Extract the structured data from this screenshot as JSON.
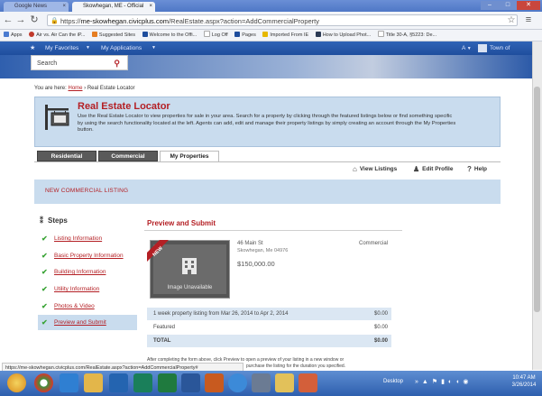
{
  "browser": {
    "tabs": [
      {
        "label": "Google News",
        "active": false
      },
      {
        "label": "Skowhegan, ME - Official",
        "active": true
      }
    ],
    "url_prefix": "https://",
    "url_host": "me-skowhegan.civicplus.com",
    "url_path": "/RealEstate.aspx?action=AddCommercialProperty",
    "bookmarks": [
      {
        "label": "Apps",
        "color": "#4a7bd0"
      },
      {
        "label": "Air vs. Air Can the iP...",
        "color": "#c0392b"
      },
      {
        "label": "Suggested Sites",
        "color": "#e67e22"
      },
      {
        "label": "Welcome to the Offi...",
        "color": "#1f4e9d"
      },
      {
        "label": "Log Off",
        "color": "#cccccc"
      },
      {
        "label": "Pages",
        "color": "#1f4e9d"
      },
      {
        "label": "Imported From IE",
        "color": "#e6b800"
      },
      {
        "label": "How to Upload Phot...",
        "color": "#2b3a55"
      },
      {
        "label": "Title 30-A, §5223: De...",
        "color": "#cccccc"
      }
    ],
    "status_url": "https://me-skowhegan.civicplus.com/RealEstate.aspx?action=AddCommercialProperty#"
  },
  "site": {
    "nav": {
      "favorites": "My Favorites",
      "applications": "My Applications",
      "town": "Town of"
    },
    "search_placeholder": "Search",
    "breadcrumb": {
      "prefix": "You are here:",
      "home": "Home",
      "current": "Real Estate Locator"
    },
    "title": "Real Estate Locator",
    "description": "Use the Real Estate Locator to view properties for sale in your area. Search for a property by clicking through the featured listings below or find something specific by using the search functionality located at the left. Agents can add, edit and manage their property listings by simply creating an account through the My Properties button.",
    "tabs": [
      {
        "label": "Residential",
        "active": false
      },
      {
        "label": "Commercial",
        "active": false
      },
      {
        "label": "My Properties",
        "active": true
      }
    ],
    "toolbar": {
      "view_listings": "View Listings",
      "edit_profile": "Edit Profile",
      "help": "Help"
    },
    "new_listing_label": "NEW COMMERCIAL LISTING"
  },
  "steps": {
    "title": "Steps",
    "items": [
      {
        "label": "Listing Information",
        "done": true,
        "active": false
      },
      {
        "label": "Basic Property Information",
        "done": true,
        "active": false
      },
      {
        "label": "Building Information",
        "done": true,
        "active": false
      },
      {
        "label": "Utility Information",
        "done": true,
        "active": false
      },
      {
        "label": "Photos & Video",
        "done": true,
        "active": false
      },
      {
        "label": "Preview and Submit",
        "done": true,
        "active": true
      }
    ]
  },
  "preview": {
    "title": "Preview and Submit",
    "ribbon": "NEW",
    "image_label": "Image Unavailable",
    "address": "46 Main St",
    "city": "Skowhegan, Me 04976",
    "price": "$150,000.00",
    "type": "Commercial",
    "fees": [
      {
        "label": "1 week property listing from Mar 26, 2014 to Apr 2, 2014",
        "amount": "$0.00",
        "style": "blue"
      },
      {
        "label": "Featured",
        "amount": "$0.00",
        "style": "plain"
      },
      {
        "label": "TOTAL",
        "amount": "$0.00",
        "style": "total"
      }
    ],
    "note_line1": "After completing the form above, click Preview to open a preview of your listing in a new window or",
    "note_line2": "purchase the listing for the duration you specified."
  },
  "taskbar": {
    "desktop_label": "Desktop",
    "time": "10:47 AM",
    "date": "3/26/2014",
    "apps": [
      {
        "name": "windows-start-icon",
        "color": "#e8b530"
      },
      {
        "name": "chrome-icon",
        "color": "#3f8f3b"
      },
      {
        "name": "ie-icon",
        "color": "#2f7fd2"
      },
      {
        "name": "explorer-icon",
        "color": "#e3b64a"
      },
      {
        "name": "outlook-icon",
        "color": "#2464b0"
      },
      {
        "name": "media-player-icon",
        "color": "#1a7f5a"
      },
      {
        "name": "excel-icon",
        "color": "#1f7a3e"
      },
      {
        "name": "word-icon",
        "color": "#2a5699"
      },
      {
        "name": "powerpoint-icon",
        "color": "#c85a1f"
      },
      {
        "name": "ie-blue-icon",
        "color": "#3c8ad8"
      },
      {
        "name": "calculator-icon",
        "color": "#6b7b93"
      },
      {
        "name": "folder-icon",
        "color": "#e2c15a"
      },
      {
        "name": "paint-icon",
        "color": "#d35f3a"
      }
    ]
  }
}
